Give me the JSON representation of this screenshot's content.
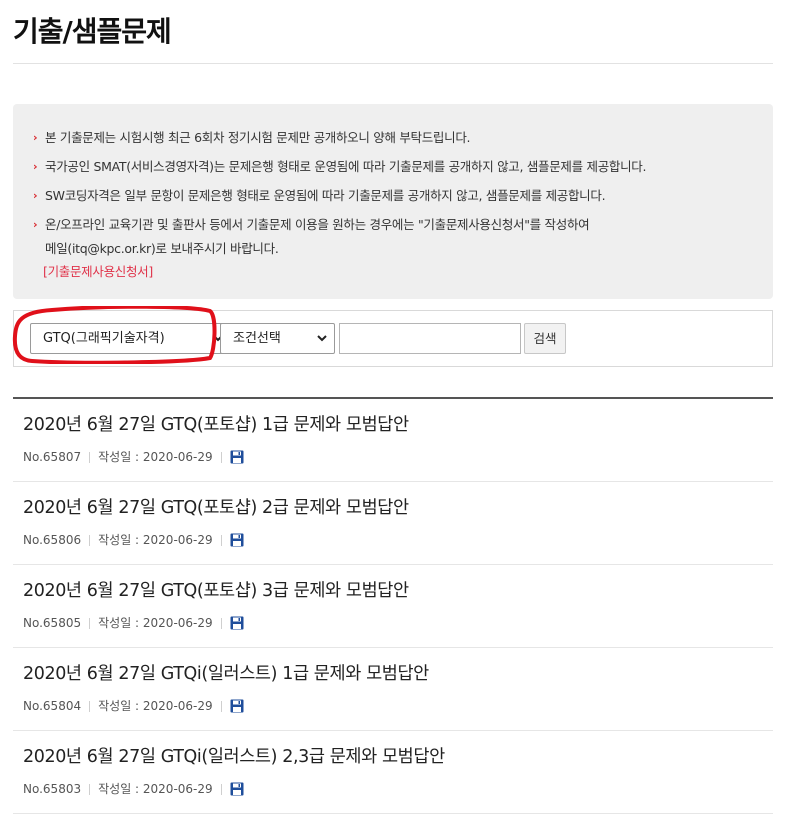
{
  "page": {
    "title": "기출/샘플문제"
  },
  "notice": {
    "items": [
      {
        "lines": [
          "본 기출문제는 시험시행 최근 6회차 정기시험 문제만 공개하오니 양해 부탁드립니다."
        ]
      },
      {
        "lines": [
          "국가공인 SMAT(서비스경영자격)는 문제은행 형태로 운영됨에 따라 기출문제를 공개하지 않고, 샘플문제를 제공합니다."
        ]
      },
      {
        "lines": [
          "SW코딩자격은 일부 문항이 문제은행 형태로 운영됨에 따라 기출문제를 공개하지 않고, 샘플문제를 제공합니다."
        ]
      },
      {
        "lines": [
          "온/오프라인 교육기관 및 출판사 등에서 기출문제 이용을 원하는 경우에는 \"기출문제사용신청서\"를 작성하여",
          "메일(itq@kpc.or.kr)로 보내주시기 바랍니다."
        ]
      }
    ],
    "link_label": "[기출문제사용신청서]",
    "bullet_color": "#d8272d",
    "link_color": "#e0334a"
  },
  "search": {
    "exam_select_value": "GTQ(그래픽기술자격)",
    "condition_select_value": "조건선택",
    "keyword_value": "",
    "button_label": "검색",
    "highlight_color": "#e0101a"
  },
  "posts": [
    {
      "title": "2020년 6월 27일 GTQ(포토샵) 1급 문제와 모범답안",
      "no": "No.65807",
      "date": "작성일 : 2020-06-29",
      "icon": "save-icon"
    },
    {
      "title": "2020년 6월 27일 GTQ(포토샵) 2급 문제와 모범답안",
      "no": "No.65806",
      "date": "작성일 : 2020-06-29",
      "icon": "save-icon"
    },
    {
      "title": "2020년 6월 27일 GTQ(포토샵) 3급 문제와 모범답안",
      "no": "No.65805",
      "date": "작성일 : 2020-06-29",
      "icon": "save-icon"
    },
    {
      "title": "2020년 6월 27일 GTQi(일러스트) 1급 문제와 모범답안",
      "no": "No.65804",
      "date": "작성일 : 2020-06-29",
      "icon": "save-icon"
    },
    {
      "title": "2020년 6월 27일 GTQi(일러스트) 2,3급 문제와 모범답안",
      "no": "No.65803",
      "date": "작성일 : 2020-06-29",
      "icon": "save-icon"
    }
  ]
}
